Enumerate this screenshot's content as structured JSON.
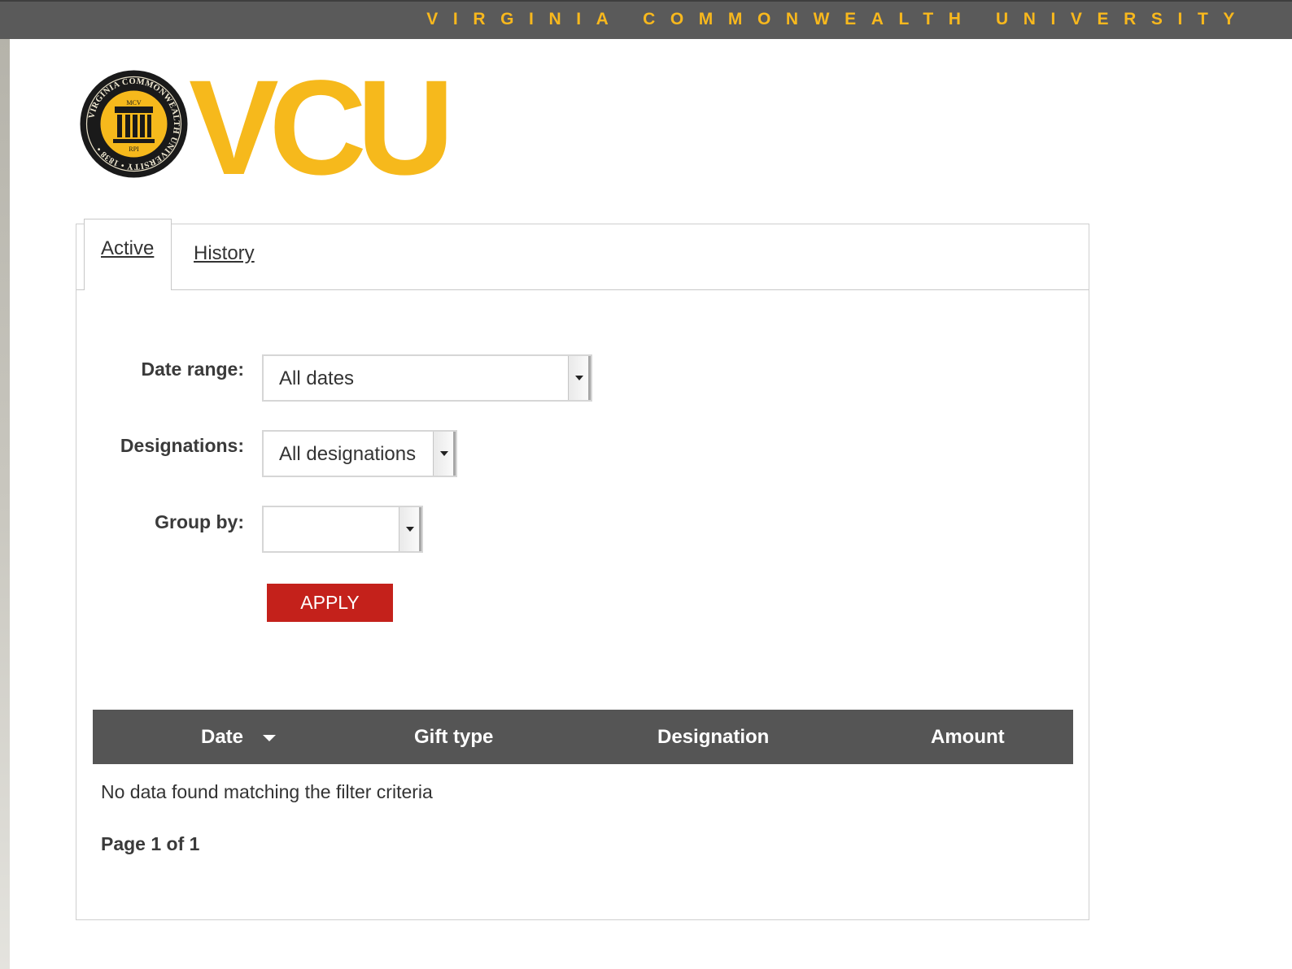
{
  "header": {
    "university_name": "VIRGINIA COMMONWEALTH UNIVERSITY",
    "wordmark": "VCU",
    "brand_color": "#f6b91c"
  },
  "seal": {
    "outer_text": "VIRGINIA COMMONWEALTH UNIVERSITY",
    "top_label": "MCV",
    "bottom_label": "RPI",
    "year": "1838"
  },
  "tabs": [
    {
      "label": "Active",
      "selected": true
    },
    {
      "label": "History",
      "selected": false
    }
  ],
  "filters": {
    "date_range": {
      "label": "Date range:",
      "value": "All dates"
    },
    "designations": {
      "label": "Designations:",
      "value": "All designations"
    },
    "group_by": {
      "label": "Group by:",
      "value": ""
    },
    "apply_label": "APPLY",
    "apply_color": "#c4211b"
  },
  "table": {
    "columns": [
      "Date",
      "Gift type",
      "Designation",
      "Amount"
    ],
    "sorted_column": "Date",
    "sort_direction": "descending",
    "empty_message": "No data found matching the filter criteria",
    "pagination": "Page 1 of 1",
    "header_color": "#555555"
  }
}
